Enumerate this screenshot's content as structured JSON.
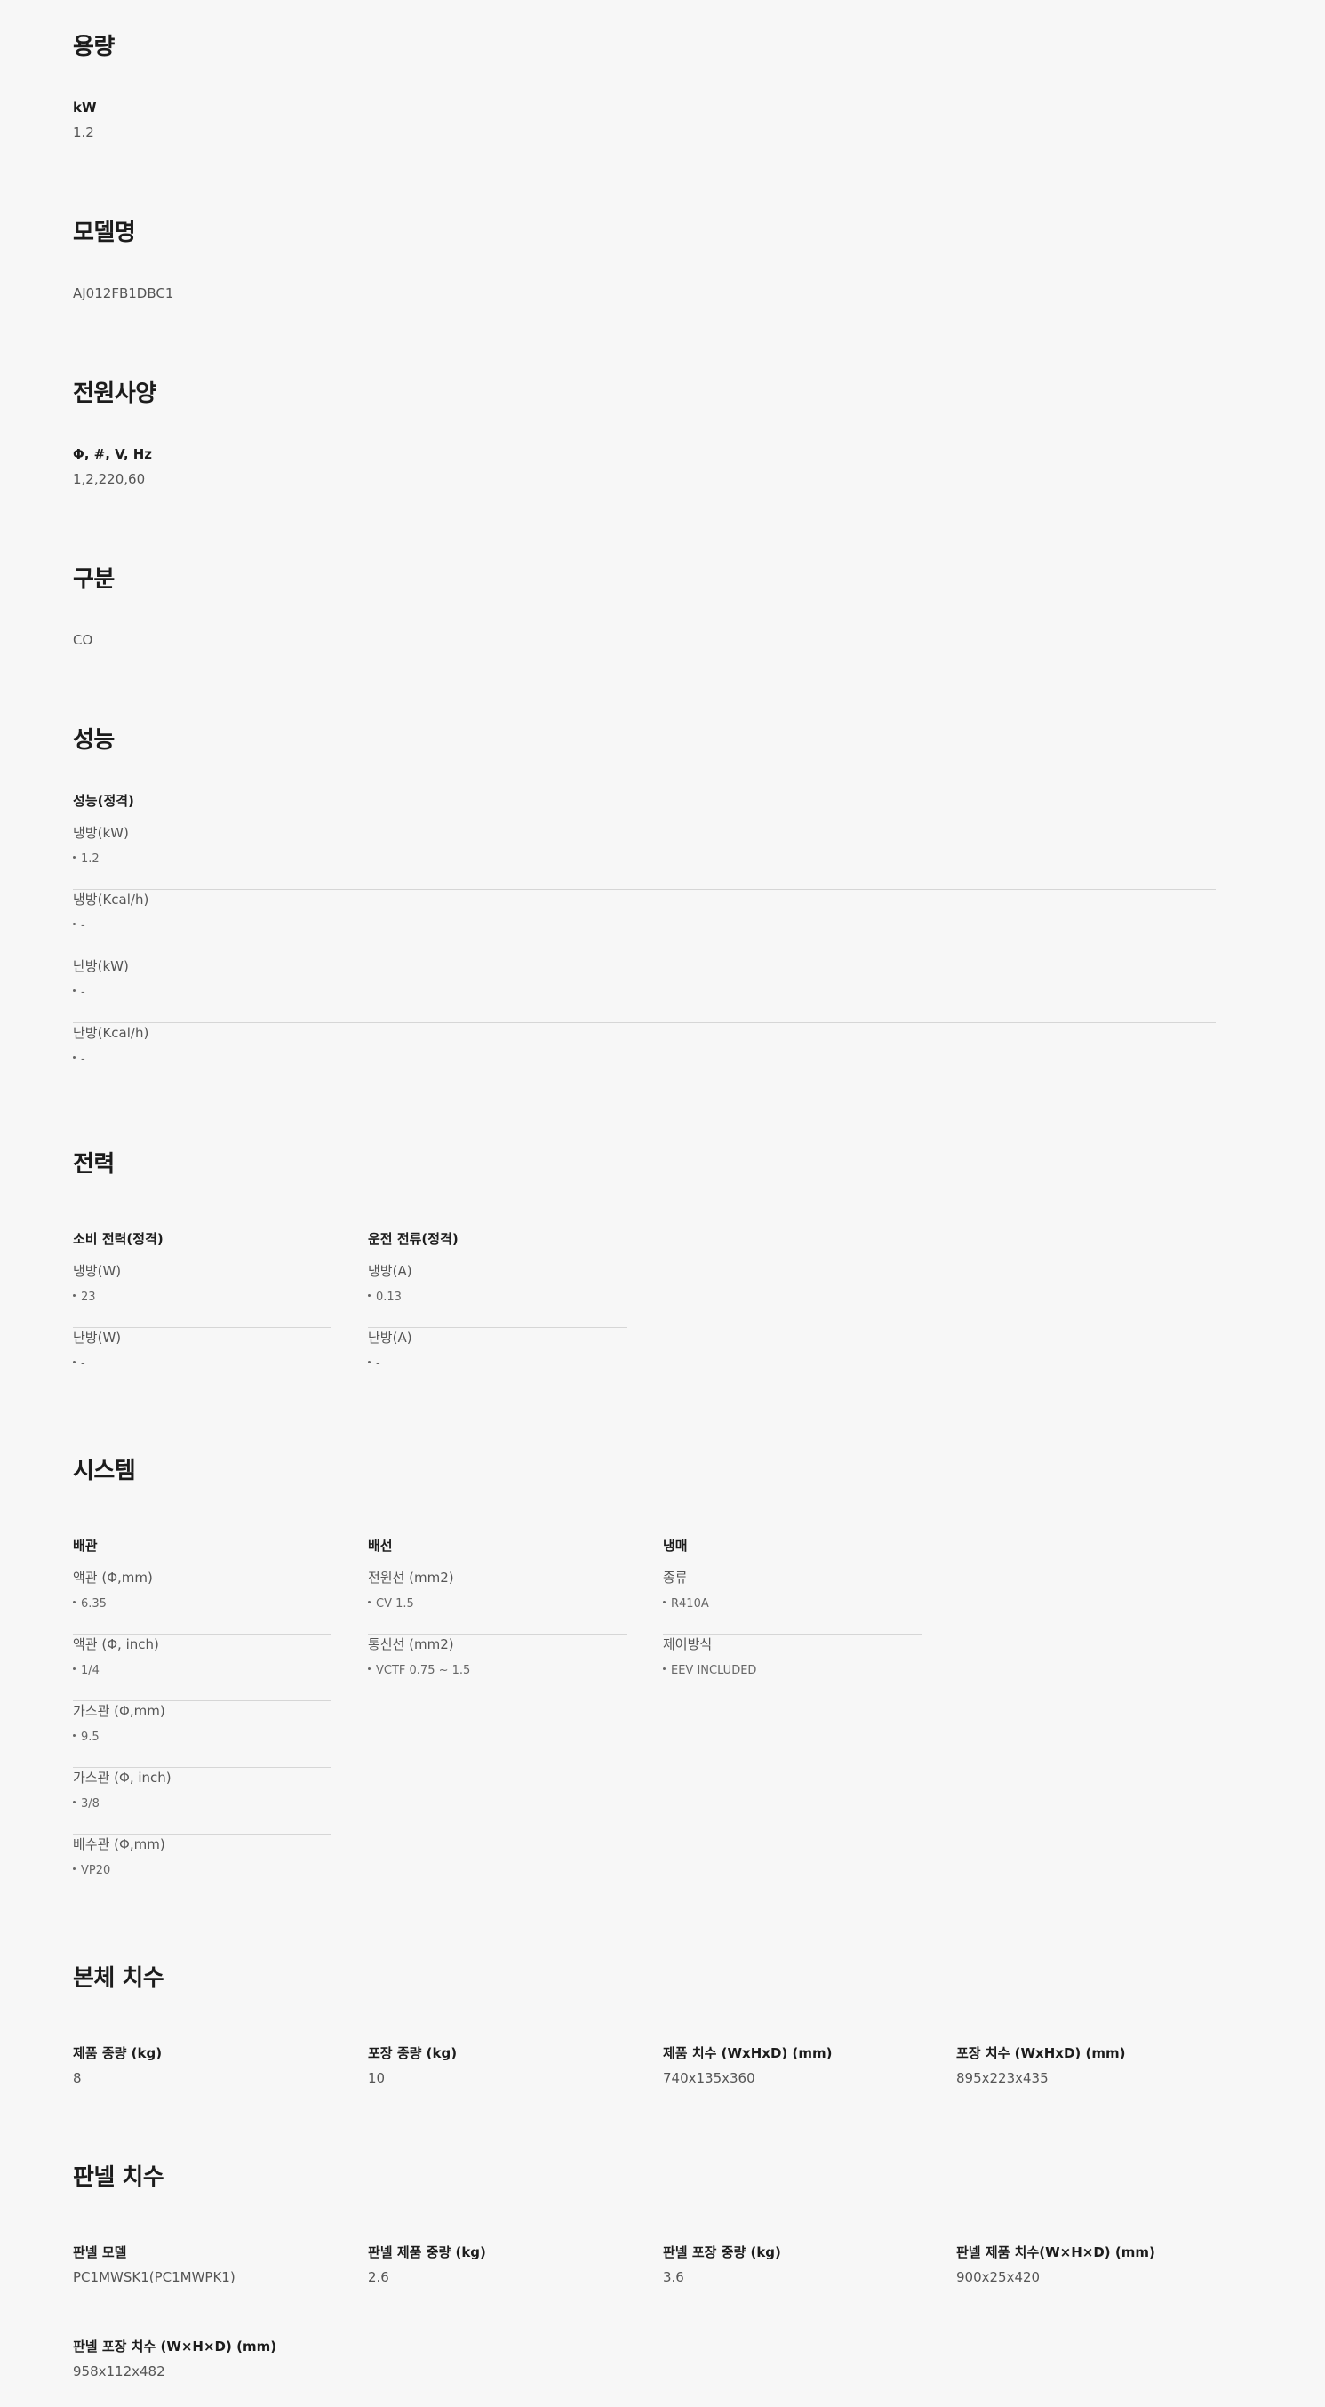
{
  "capacity": {
    "title": "용량",
    "name": "kW",
    "value": "1.2"
  },
  "model": {
    "title": "모델명",
    "value": "AJ012FB1DBC1"
  },
  "power_spec": {
    "title": "전원사양",
    "name": "Φ, #, V, Hz",
    "value": "1,2,220,60"
  },
  "division": {
    "title": "구분",
    "value": "CO"
  },
  "performance": {
    "title": "성능",
    "group": "성능(정격)",
    "items": [
      {
        "label": "냉방(kW)",
        "value": "1.2"
      },
      {
        "label": "냉방(Kcal/h)",
        "value": "-"
      },
      {
        "label": "난방(kW)",
        "value": "-"
      },
      {
        "label": "난방(Kcal/h)",
        "value": "-"
      }
    ]
  },
  "electric": {
    "title": "전력",
    "groups": [
      {
        "title": "소비 전력(정격)",
        "items": [
          {
            "label": "냉방(W)",
            "value": "23"
          },
          {
            "label": "난방(W)",
            "value": "-"
          }
        ]
      },
      {
        "title": "운전 전류(정격)",
        "items": [
          {
            "label": "냉방(A)",
            "value": "0.13"
          },
          {
            "label": "난방(A)",
            "value": "-"
          }
        ]
      }
    ]
  },
  "system": {
    "title": "시스템",
    "groups": [
      {
        "title": "배관",
        "items": [
          {
            "label": "액관 (Φ,mm)",
            "value": "6.35"
          },
          {
            "label": "액관 (Φ, inch)",
            "value": "1/4"
          },
          {
            "label": "가스관 (Φ,mm)",
            "value": "9.5"
          },
          {
            "label": "가스관 (Φ, inch)",
            "value": "3/8"
          },
          {
            "label": "배수관 (Φ,mm)",
            "value": "VP20"
          }
        ]
      },
      {
        "title": "배선",
        "items": [
          {
            "label": "전원선 (mm2)",
            "value": "CV 1.5"
          },
          {
            "label": "통신선 (mm2)",
            "value": "VCTF 0.75 ~ 1.5"
          }
        ]
      },
      {
        "title": "냉매",
        "items": [
          {
            "label": "종류",
            "value": "R410A"
          },
          {
            "label": "제어방식",
            "value": "EEV INCLUDED"
          }
        ]
      }
    ]
  },
  "body_dim": {
    "title": "본체 치수",
    "specs": [
      {
        "name": "제품 중량 (kg)",
        "value": "8"
      },
      {
        "name": "포장 중량 (kg)",
        "value": "10"
      },
      {
        "name": "제품 치수 (WxHxD) (mm)",
        "value": "740x135x360"
      },
      {
        "name": "포장 치수 (WxHxD) (mm)",
        "value": "895x223x435"
      }
    ]
  },
  "panel_dim": {
    "title": "판넬 치수",
    "specs": [
      {
        "name": "판넬 모델",
        "value": "PC1MWSK1(PC1MWPK1)"
      },
      {
        "name": "판넬 제품 중량 (kg)",
        "value": "2.6"
      },
      {
        "name": "판넬 포장 중량 (kg)",
        "value": "3.6"
      },
      {
        "name": "판넬 제품 치수(W×H×D) (mm)",
        "value": "900x25x420"
      },
      {
        "name": "판넬 포장 치수 (W×H×D) (mm)",
        "value": "958x112x482"
      }
    ]
  }
}
